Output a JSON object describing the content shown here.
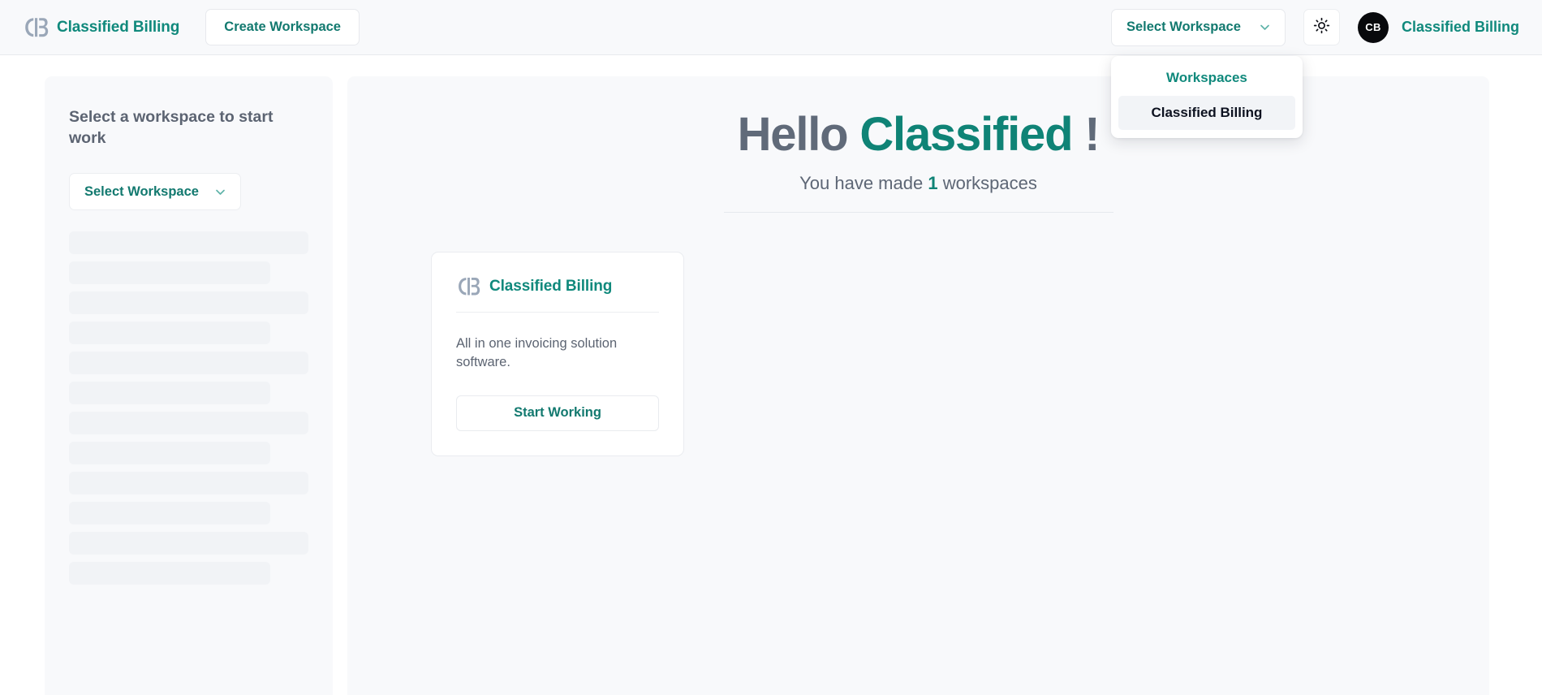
{
  "header": {
    "brand_name": "Classified Billing",
    "brand_logo_icon": "cb-logo-icon",
    "create_workspace_label": "Create Workspace",
    "workspace_select_label": "Select Workspace",
    "workspace_select_chevron_icon": "chevron-down-icon",
    "theme_toggle_icon": "sun-icon",
    "avatar_initials": "CB",
    "user_name": "Classified Billing"
  },
  "workspace_dropdown": {
    "title": "Workspaces",
    "items": [
      {
        "label": "Classified Billing",
        "selected": true
      }
    ]
  },
  "sidebar": {
    "title": "Select a workspace to start work",
    "select_label": "Select Workspace",
    "select_chevron_icon": "chevron-down-icon",
    "skeleton_count": 12
  },
  "main": {
    "greeting_prefix": "Hello",
    "greeting_name": "Classified",
    "greeting_suffix": "!",
    "subtitle_prefix": "You have made",
    "subtitle_count": "1",
    "subtitle_suffix": "workspaces",
    "workspace_card": {
      "logo_icon": "cb-logo-icon",
      "title": "Classified Billing",
      "description": "All in one invoicing solution software.",
      "button_label": "Start Working"
    }
  },
  "colors": {
    "brand_teal": "#10897c",
    "accent_teal": "#0f8376",
    "text_gray": "#5c6472",
    "panel_bg": "#f8f9fb",
    "skeleton": "#f1f3f6",
    "avatar_bg": "#08090c",
    "logo_gray": "#9aa7b8"
  }
}
